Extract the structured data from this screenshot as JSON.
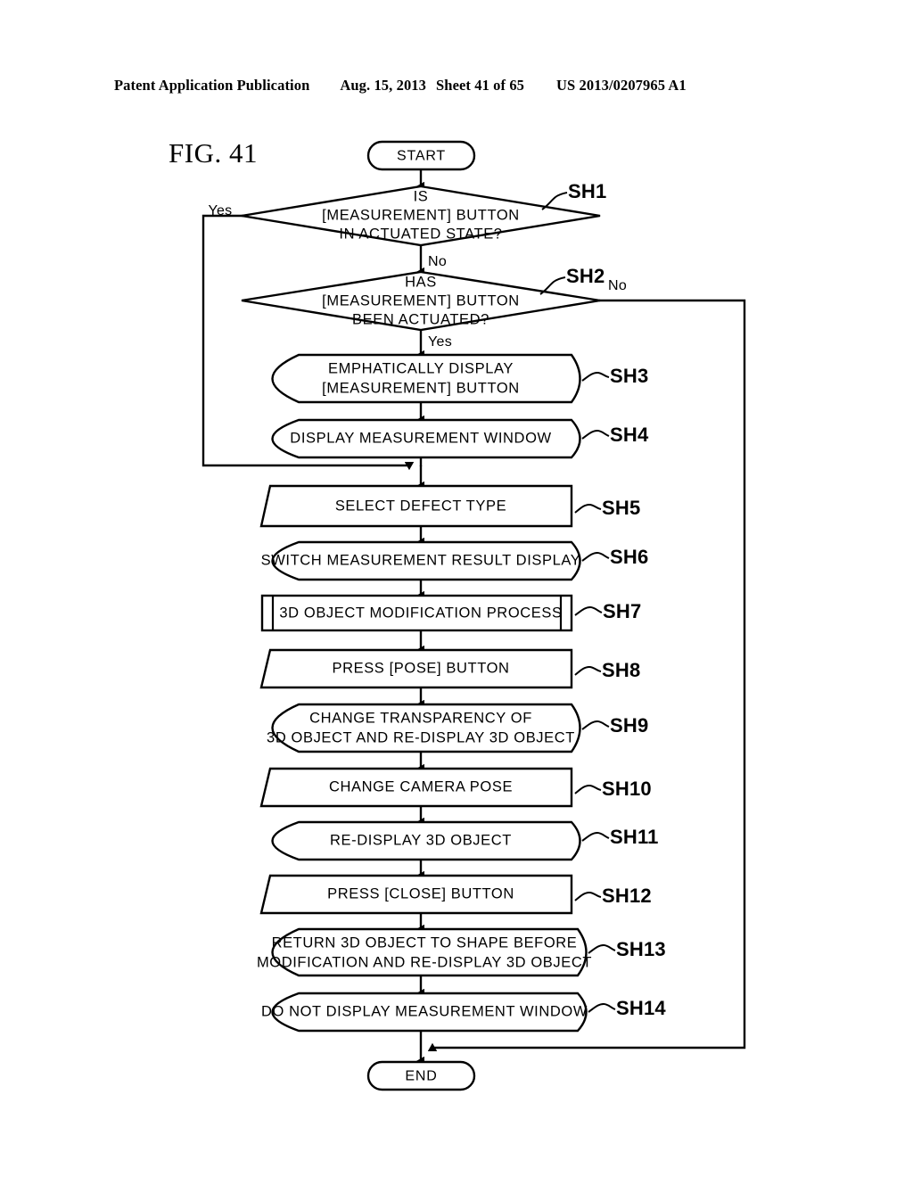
{
  "header": {
    "publication": "Patent Application Publication",
    "date": "Aug. 15, 2013",
    "sheet": "Sheet 41 of 65",
    "document_number": "US 2013/0207965 A1"
  },
  "figure": {
    "label": "FIG. 41"
  },
  "terminals": {
    "start": "START",
    "end": "END"
  },
  "branch_labels": {
    "sh1_yes": "Yes",
    "sh1_no": "No",
    "sh2_no": "No",
    "sh2_yes": "Yes"
  },
  "nodes": [
    {
      "id": "SH1",
      "tag": "SH1",
      "shape": "decision",
      "lines": [
        "IS",
        "[MEASUREMENT] BUTTON",
        "IN ACTUATED STATE?"
      ]
    },
    {
      "id": "SH2",
      "tag": "SH2",
      "shape": "decision",
      "lines": [
        "HAS",
        "[MEASUREMENT] BUTTON",
        "BEEN ACTUATED?"
      ]
    },
    {
      "id": "SH3",
      "tag": "SH3",
      "shape": "display",
      "lines": [
        "EMPHATICALLY DISPLAY",
        "[MEASUREMENT] BUTTON"
      ]
    },
    {
      "id": "SH4",
      "tag": "SH4",
      "shape": "display",
      "lines": [
        "DISPLAY MEASUREMENT WINDOW"
      ]
    },
    {
      "id": "SH5",
      "tag": "SH5",
      "shape": "manual-input",
      "lines": [
        "SELECT DEFECT TYPE"
      ]
    },
    {
      "id": "SH6",
      "tag": "SH6",
      "shape": "display",
      "lines": [
        "SWITCH MEASUREMENT RESULT DISPLAY"
      ]
    },
    {
      "id": "SH7",
      "tag": "SH7",
      "shape": "predefined-process",
      "lines": [
        "3D OBJECT MODIFICATION PROCESS"
      ]
    },
    {
      "id": "SH8",
      "tag": "SH8",
      "shape": "manual-input",
      "lines": [
        "PRESS [POSE] BUTTON"
      ]
    },
    {
      "id": "SH9",
      "tag": "SH9",
      "shape": "display",
      "lines": [
        "CHANGE TRANSPARENCY OF",
        "3D OBJECT AND RE-DISPLAY 3D OBJECT"
      ]
    },
    {
      "id": "SH10",
      "tag": "SH10",
      "shape": "manual-input",
      "lines": [
        "CHANGE CAMERA POSE"
      ]
    },
    {
      "id": "SH11",
      "tag": "SH11",
      "shape": "display",
      "lines": [
        "RE-DISPLAY 3D OBJECT"
      ]
    },
    {
      "id": "SH12",
      "tag": "SH12",
      "shape": "manual-input",
      "lines": [
        "PRESS [CLOSE] BUTTON"
      ]
    },
    {
      "id": "SH13",
      "tag": "SH13",
      "shape": "display",
      "lines": [
        "RETURN 3D OBJECT TO SHAPE BEFORE",
        "MODIFICATION AND RE-DISPLAY 3D OBJECT"
      ]
    },
    {
      "id": "SH14",
      "tag": "SH14",
      "shape": "display",
      "lines": [
        "DO NOT DISPLAY MEASUREMENT WINDOW"
      ]
    }
  ],
  "colors": {
    "ink": "#000000",
    "paper": "#ffffff"
  }
}
